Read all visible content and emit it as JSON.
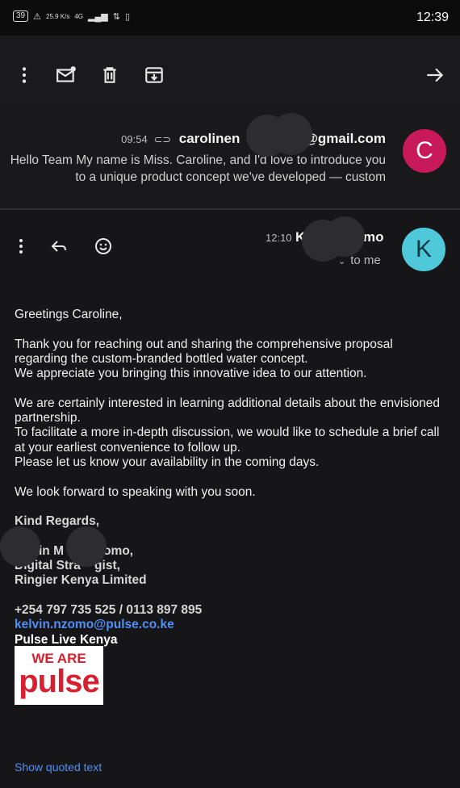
{
  "status_bar": {
    "battery": "39",
    "network_speed": "25.9 K/s",
    "network_type": "4G",
    "time": "12:39"
  },
  "toolbar": {
    "icons": [
      "more-vert-icon",
      "mark-unread-icon",
      "delete-icon",
      "archive-icon",
      "forward-arrow-icon"
    ]
  },
  "collapsed_message": {
    "time": "09:54",
    "sender_visible_start": "carolinen",
    "sender_visible_end": "@gmail.com",
    "avatar_letter": "C",
    "avatar_color": "#c8195a",
    "snippet": "Hello Team My name is Miss. Caroline, and I'd love to introduce you to a unique product concept we've developed — custom"
  },
  "expanded_message": {
    "time": "12:10",
    "sender_visible_start": "K",
    "sender_visible_end": "mo",
    "recipient_label": "to me",
    "avatar_letter": "K",
    "avatar_color": "#4fc8da",
    "body": {
      "greeting": "Greetings Caroline,",
      "p1_l1": "Thank you for reaching out and sharing the comprehensive proposal",
      "p1_l2": "regarding the custom-branded bottled water concept.",
      "p1_l3": "We appreciate you bringing this innovative idea to our attention.",
      "p2_l1": "We are certainly interested in learning additional details about the envisioned",
      "p2_l2": "partnership.",
      "p2_l3": "To facilitate a more in-depth discussion, we would like to schedule a brief call",
      "p2_l4": "at your earliest convenience to follow up.",
      "p2_l5": "Please let us know your availability in the coming days.",
      "p3": "We look forward to speaking with you soon."
    },
    "signature": {
      "closing": "Kind Regards,",
      "name_line": "in M       Nzomo,",
      "title_line": "Digital Stra    gist,",
      "company": "Ringier Kenya Limited",
      "phones": "+254 797 735 525 / 0113 897 895",
      "email": "kelvin.nzomo@pulse.co.ke",
      "brand": "Pulse Live Kenya",
      "logo_top": "WE ARE",
      "logo_bottom": "pulse"
    },
    "quoted_link": "Show quoted text"
  },
  "colors": {
    "background": "#161618",
    "link": "#4f8ff7",
    "brand_red": "#d62030"
  }
}
